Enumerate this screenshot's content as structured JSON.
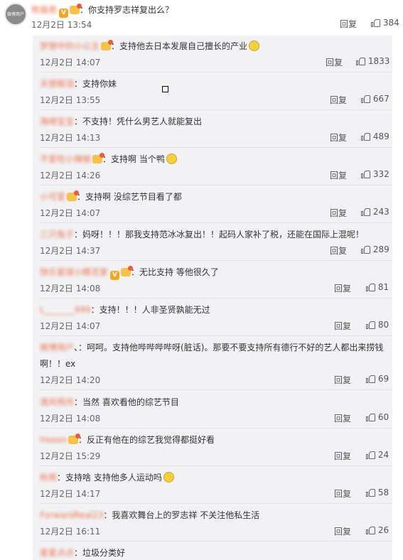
{
  "main": {
    "avatar_text": "微博用户",
    "username": "熊猫君",
    "text": "：你支持罗志祥复出么？",
    "time": "12月2日 13:54",
    "reply_label": "回复",
    "likes": "384"
  },
  "replies": [
    {
      "username": "梦想中的小公主",
      "badge": true,
      "text": "：支持他去日本发展自己擅长的产业",
      "emoji": true,
      "time": "12月2日 14:07",
      "reply_label": "回复",
      "likes": "1833"
    },
    {
      "username": "天使眼泪",
      "text": "：支持你妹",
      "time": "12月2日 13:55",
      "reply_label": "回复",
      "likes": "667"
    },
    {
      "username": "海绵宝宝",
      "text": "：不支持！凭什么男艺人就能复出",
      "time": "12月2日 14:13",
      "reply_label": "回复",
      "likes": "489"
    },
    {
      "username": "不爱吃小辣椒",
      "badge": true,
      "text": "：支持啊 当个鸭",
      "emoji": true,
      "time": "12月2日 14:26",
      "reply_label": "回复",
      "likes": "332"
    },
    {
      "username": "小可爱",
      "badge": true,
      "text": "：支持啊 没综艺节目看了都",
      "time": "12月2日 14:07",
      "reply_label": "回复",
      "likes": "243"
    },
    {
      "username": "三只兔子",
      "text": "：妈呀！！！那我支持范冰冰复出！！起码人家补了税，还能在国际上混呢！",
      "time": "12月2日 14:37",
      "reply_label": "回复",
      "likes": "289"
    },
    {
      "username": "快乐星球小精灵家",
      "vbadge": true,
      "badge": true,
      "text": "：无比支持 等他很久了",
      "time": "12月2日 14:08",
      "reply_label": "回复",
      "likes": "81"
    },
    {
      "username": "L_______999",
      "text": "：支持！！！人非圣贤孰能无过",
      "time": "12月2日 14:07",
      "reply_label": "回复",
      "likes": "80"
    },
    {
      "username": "微博用户",
      "text": "、：呵呵。支持他哔哔哔哔呀(脏话)。那要不要支持所有德行不好的艺人都出来捞钱",
      "text2": "啊！！ex",
      "time": "12月2日 14:20",
      "reply_label": "回复",
      "likes": "69"
    },
    {
      "username": "清风明月",
      "text": "：当然 喜欢看他的综艺节目",
      "time": "12月2日 14:08",
      "reply_label": "回复",
      "likes": "60"
    },
    {
      "username": "Hxoon",
      "badge": true,
      "text": "：反正有他在的综艺我觉得都挺好看",
      "time": "12月2日 15:29",
      "reply_label": "回复",
      "likes": "24"
    },
    {
      "username": "秋雨",
      "text": "：支持啥 支持他多人运动吗",
      "emoji": true,
      "time": "12月2日 14:17",
      "reply_label": "回复",
      "likes": "58"
    },
    {
      "username": "ForwardReal23",
      "text": "：我喜欢舞台上的罗志祥  不关注他私生活",
      "time": "12月2日 16:11",
      "reply_label": "回复",
      "likes": "26"
    },
    {
      "username": "星星点点",
      "text": "：垃圾分类好"
    }
  ],
  "colors": {
    "username": "#eb7350",
    "reply_bg": "#f2f2f5",
    "badge": "#f5a623"
  }
}
